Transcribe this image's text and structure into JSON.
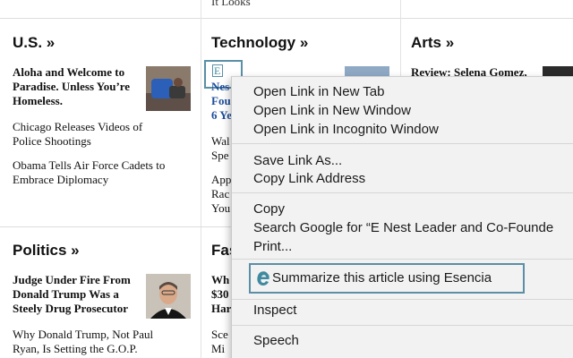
{
  "top_snippet": "It Looks",
  "sections": {
    "us": {
      "title": "U.S. »",
      "stories": [
        "Aloha and Welcome to",
        "Paradise. Unless You’re",
        "Homeless.",
        "Chicago Releases Videos of",
        "Police Shootings",
        "Obama Tells Air Force Cadets to",
        "Embrace Diplomacy"
      ]
    },
    "technology": {
      "title": "Technology »",
      "selected_fragments": [
        "Nes",
        "Fou",
        "6 Ye"
      ],
      "fragments": [
        "Wal",
        "Spe",
        "App",
        "Rac",
        "You"
      ]
    },
    "arts": {
      "title": "Arts »",
      "story": "Review: Selena Gomez,"
    },
    "politics": {
      "title": "Politics »",
      "stories": [
        "Judge Under Fire From",
        "Donald Trump Was a",
        "Steely Drug Prosecutor",
        "Why Donald Trump, Not Paul",
        "Ryan, Is Setting the G.O.P."
      ]
    },
    "fashion": {
      "title_fragment": "Fas",
      "fragments": [
        "Wh",
        "$30",
        "Har",
        "Sce",
        "Mi"
      ]
    }
  },
  "context_menu": {
    "items": {
      "open_new_tab": "Open Link in New Tab",
      "open_new_window": "Open Link in New Window",
      "open_incognito": "Open Link in Incognito Window",
      "save_link": "Save Link As...",
      "copy_link": "Copy Link Address",
      "copy": "Copy",
      "search_google": "Search Google for “E  Nest Leader and Co-Founde",
      "print": "Print...",
      "summarize": "Summarize this article using Esencia",
      "inspect": "Inspect",
      "speech": "Speech"
    }
  },
  "colors": {
    "highlight": "#5a8fa6",
    "selection_text": "#1f4e9c",
    "esencia_logo": "#3f8aa0"
  }
}
